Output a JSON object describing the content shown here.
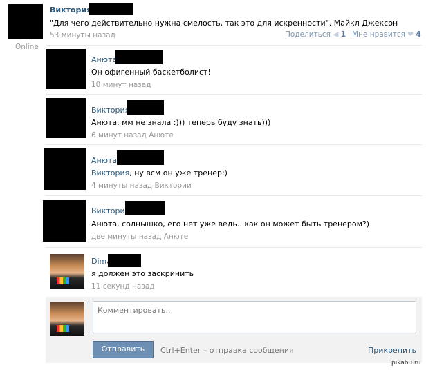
{
  "post": {
    "author": "Виктория",
    "text": "\"Для чего действительно нужна смелость, так это для искренности\". Майкл Джексон",
    "time": "53 минуты назад",
    "share_label": "Поделиться",
    "share_count": "1",
    "like_label": "Мне нравится",
    "like_count": "4",
    "status": "Online"
  },
  "comments": [
    {
      "author": "Анюта",
      "text": "Он офигенный баскетболист!",
      "meta": "10 минут назад"
    },
    {
      "author": "Виктория",
      "text": "Анюта, мм не знала :))) теперь буду знать)))",
      "meta": "6 минут назад Анюте"
    },
    {
      "author": "Анюта",
      "mention": "Виктория",
      "text_after": ", ну всм он уже тренер:)",
      "meta": "4 минуты назад Виктории"
    },
    {
      "author": "Виктория",
      "text": "Анюта, солнышко, его нет уже ведь.. как он может быть тренером?)",
      "meta": "две минуты назад Анюте"
    },
    {
      "author": "Dima",
      "text": "я должен это заскринить",
      "meta": "11 секунд назад"
    }
  ],
  "reply": {
    "placeholder": "Комментировать..",
    "send_label": "Отправить",
    "hint": "Ctrl+Enter – отправка сообщения",
    "attach_label": "Прикрепить"
  },
  "watermark": "pikabu.ru"
}
